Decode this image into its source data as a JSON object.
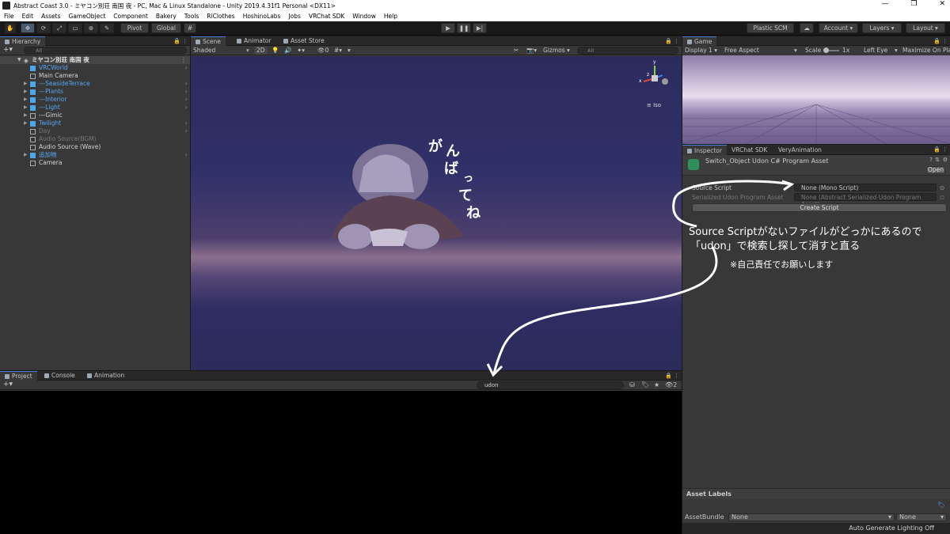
{
  "window": {
    "title": "Abstract Coast 3.0 - ミヤコン別荘 南国 夜 - PC, Mac & Linux Standalone - Unity 2019.4.31f1 Personal <DX11>",
    "controls": [
      "—",
      "❐",
      "✕"
    ]
  },
  "menu": [
    "File",
    "Edit",
    "Assets",
    "GameObject",
    "Component",
    "Bakery",
    "Tools",
    "RiClothes",
    "HoshinoLabs",
    "Jobs",
    "VRChat SDK",
    "Window",
    "Help"
  ],
  "toolbar": {
    "pivot": "Pivot",
    "global": "Global",
    "plastic": "Plastic SCM",
    "account": "Account",
    "layers": "Layers",
    "layout": "Layout"
  },
  "hierarchy": {
    "tab": "Hierarchy",
    "search_placeholder": "All",
    "scene_name": "ミヤコン別荘 南国 夜",
    "items": [
      {
        "label": "VRCWorld",
        "color": "blue",
        "cube": "blue",
        "arrow": false,
        "more": true
      },
      {
        "label": "Main Camera",
        "color": "norm",
        "cube": "plain",
        "arrow": false,
        "more": false
      },
      {
        "label": "---SeasideTerrace",
        "color": "blue",
        "cube": "blue",
        "arrow": true,
        "more": true
      },
      {
        "label": "---Plants",
        "color": "blue",
        "cube": "blue",
        "arrow": true,
        "more": true
      },
      {
        "label": "---Interior",
        "color": "blue",
        "cube": "blue",
        "arrow": true,
        "more": true
      },
      {
        "label": "---Light",
        "color": "blue",
        "cube": "blue",
        "arrow": true,
        "more": true
      },
      {
        "label": "---Gimic",
        "color": "norm",
        "cube": "plain",
        "arrow": true,
        "more": false
      },
      {
        "label": "Twilight",
        "color": "blue",
        "cube": "blue",
        "arrow": true,
        "more": true
      },
      {
        "label": "Day",
        "color": "gray",
        "cube": "plain",
        "arrow": false,
        "more": true
      },
      {
        "label": "Audio Source(BGM)",
        "color": "gray",
        "cube": "plain",
        "arrow": false,
        "more": false
      },
      {
        "label": "Audio Source (Wave)",
        "color": "norm",
        "cube": "plain",
        "arrow": false,
        "more": false
      },
      {
        "label": "追加物",
        "color": "blue",
        "cube": "blue",
        "arrow": true,
        "more": true
      },
      {
        "label": "Camera",
        "color": "norm",
        "cube": "plain",
        "arrow": false,
        "more": false
      }
    ]
  },
  "scene": {
    "tabs": [
      "Scene",
      "Animator",
      "Asset Store"
    ],
    "shading": "Shaded",
    "mode2d": "2D",
    "gizmos": "Gizmos",
    "search_placeholder": "All",
    "iso": "Iso",
    "gizmo_axes": [
      "y",
      "x",
      "z"
    ],
    "scribble": [
      "が",
      "ん",
      "ば",
      "っ",
      "て",
      "ね"
    ]
  },
  "game": {
    "tab": "Game",
    "display": "Display 1",
    "aspect": "Free Aspect",
    "scale_label": "Scale",
    "scale_value": "1x",
    "eye": "Left Eye",
    "maximize": "Maximize On Pla"
  },
  "inspector": {
    "tabs": [
      "Inspector",
      "VRChat SDK",
      "VeryAnimation"
    ],
    "asset_title": "Switch_Object Udon C# Program Asset",
    "open_button": "Open",
    "source_script_label": "Source Script",
    "source_script_value": "None (Mono Script)",
    "serialized_label": "Serialized Udon Program Asset",
    "serialized_value": "None (Abstract Serialized Udon Program Asset)",
    "create_button": "Create Script",
    "asset_labels": "Asset Labels",
    "asset_bundle_label": "AssetBundle",
    "asset_bundle_value": "None",
    "asset_bundle_variant": "None",
    "status": "Auto Generate Lighting Off"
  },
  "project": {
    "tabs": [
      "Project",
      "Console",
      "Animation"
    ],
    "search_value": "udon",
    "hidden_count": "2"
  },
  "annotation": {
    "line1": "Source Scriptがないファイルがどっかにあるので",
    "line2": "「udon」で検索し探して消すと直る",
    "note": "※自己責任でお願いします"
  }
}
